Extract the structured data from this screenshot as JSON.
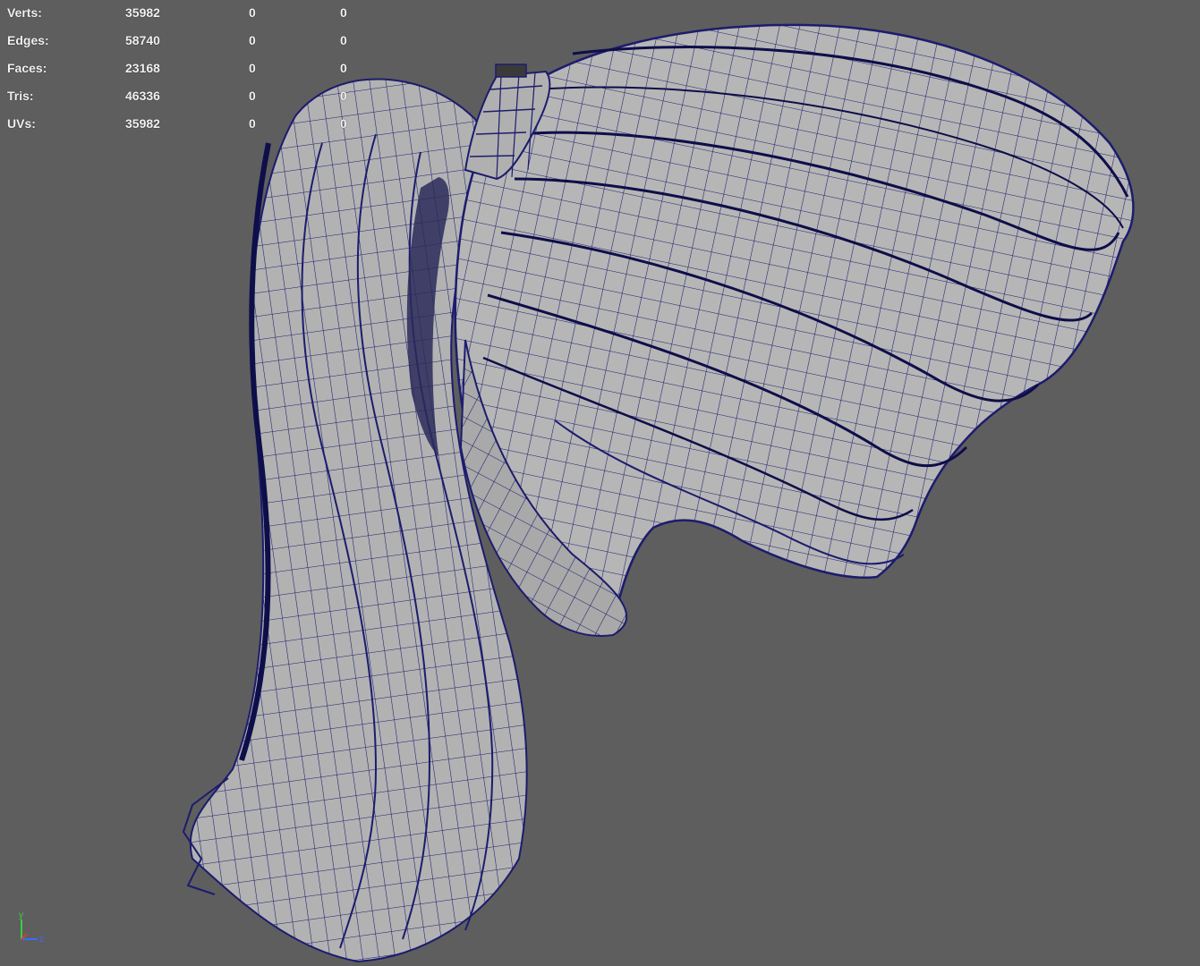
{
  "viewport": {
    "background": "#5e5e5e",
    "mesh_fill": "#b4b4b4",
    "mesh_shadow": "#8c8c8c",
    "wire_color": "#1c1c6e"
  },
  "hud": {
    "rows": [
      {
        "label": "Verts:",
        "value": "35982",
        "selected": "0",
        "uv": "0"
      },
      {
        "label": "Edges:",
        "value": "58740",
        "selected": "0",
        "uv": "0"
      },
      {
        "label": "Faces:",
        "value": "23168",
        "selected": "0",
        "uv": "0"
      },
      {
        "label": "Tris:",
        "value": "46336",
        "selected": "0",
        "uv": "0"
      },
      {
        "label": "UVs:",
        "value": "35982",
        "selected": "0",
        "uv": "0"
      }
    ]
  },
  "axis_gizmo": {
    "y_label": "y",
    "z_label": "z",
    "y_color": "#3ad13a",
    "z_color": "#3a6bff",
    "x_color": "#d83a3a"
  }
}
